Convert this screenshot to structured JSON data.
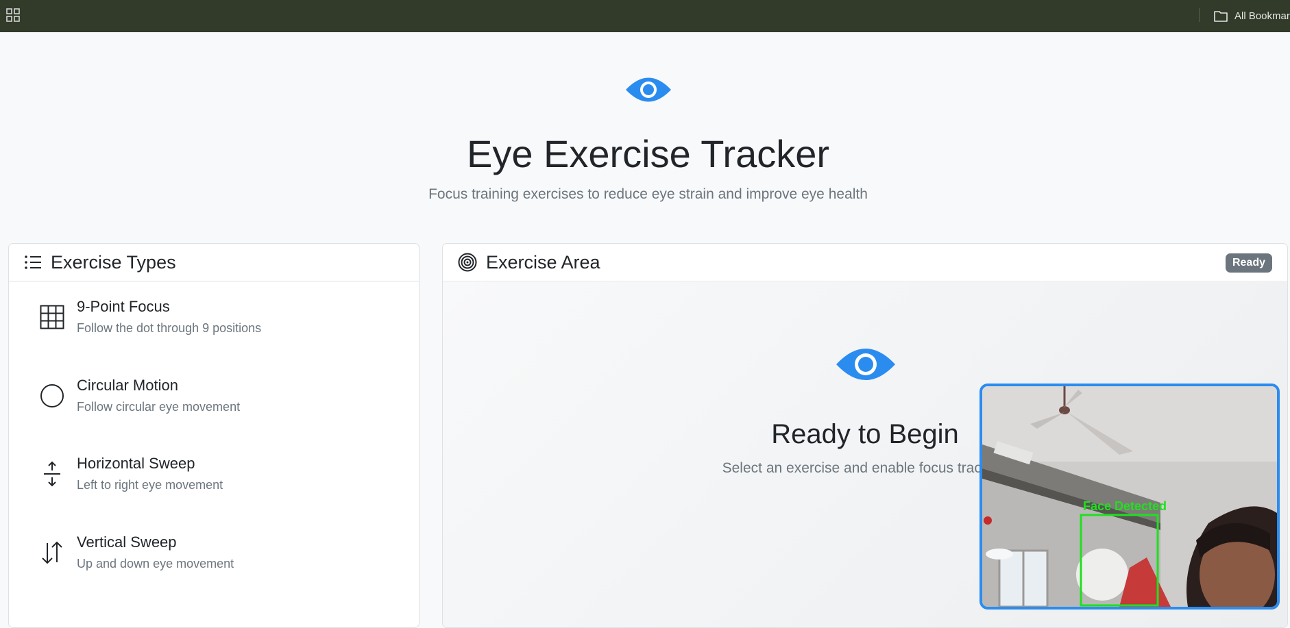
{
  "browser": {
    "apps_icon": "apps-grid-icon",
    "bookmarks_label": "All Bookmar",
    "bookmarks_icon": "folder-icon"
  },
  "header": {
    "icon": "eye-icon",
    "title": "Eye Exercise Tracker",
    "subtitle": "Focus training exercises to reduce eye strain and improve eye health"
  },
  "exercise_types": {
    "title": "Exercise Types",
    "icon": "list-icon",
    "items": [
      {
        "name": "9-Point Focus",
        "description": "Follow the dot through 9 positions",
        "icon": "grid-icon"
      },
      {
        "name": "Circular Motion",
        "description": "Follow circular eye movement",
        "icon": "circle-icon"
      },
      {
        "name": "Horizontal Sweep",
        "description": "Left to right eye movement",
        "icon": "arrows-expand-icon"
      },
      {
        "name": "Vertical Sweep",
        "description": "Up and down eye movement",
        "icon": "arrows-vertical-icon"
      }
    ]
  },
  "exercise_area": {
    "title": "Exercise Area",
    "icon": "bullseye-icon",
    "status_badge": "Ready",
    "ready_title": "Ready to Begin",
    "ready_subtitle": "Select an exercise and enable focus tracking"
  },
  "webcam": {
    "detection_label": "Face Detected"
  },
  "colors": {
    "accent": "#2b8cf0",
    "topbar": "#323b2a",
    "badge": "#6c757d",
    "detection": "#20e020"
  }
}
